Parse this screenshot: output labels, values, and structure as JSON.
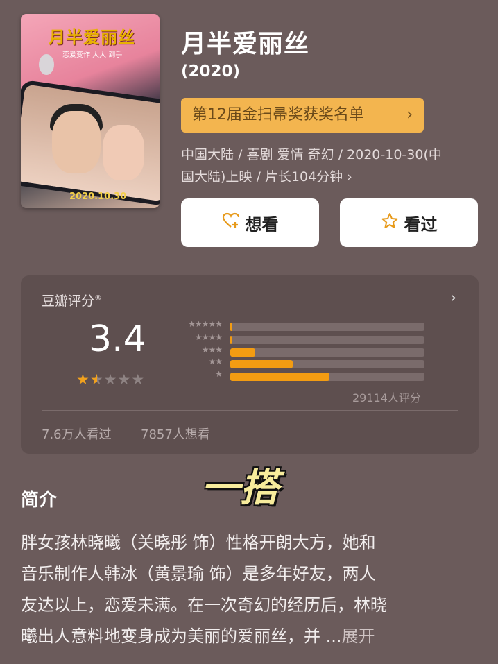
{
  "poster": {
    "title": "月半爱丽丝",
    "subtitle": "恋爱变作 大大 到手",
    "date": "2020.10.30"
  },
  "movie": {
    "title": "月半爱丽丝",
    "year": "(2020)",
    "award": "第12届金扫帚奖获奖名单",
    "meta_line1": "中国大陆 / 喜剧 爱情 奇幻 / 2020-10-30(中",
    "meta_line2": "国大陆)上映 / 片长104分钟 ›"
  },
  "actions": {
    "want_label": "想看",
    "seen_label": "看过"
  },
  "rating": {
    "label": "豆瓣评分",
    "registered": "®",
    "score": "3.4",
    "stars_filled": 1.5,
    "stars_total": 5,
    "distribution": [
      {
        "stars": "★★★★★",
        "fraction": 0.012
      },
      {
        "stars": "★★★★",
        "fraction": 0.008
      },
      {
        "stars": "★★★",
        "fraction": 0.13
      },
      {
        "stars": "★★",
        "fraction": 0.32
      },
      {
        "stars": "★",
        "fraction": 0.51
      }
    ],
    "count": "29114人评分",
    "watched": "7.6万人看过",
    "wish": "7857人想看"
  },
  "overlay_text": "一搭",
  "intro": {
    "heading": "简介",
    "lines": [
      "胖女孩林晓曦（关晓彤 饰）性格开朗大方，她和",
      "音乐制作人韩冰（黄景瑜 饰）是多年好友，两人",
      "友达以上，恋爱未满。在一次奇幻的经历后，林晓",
      "曦出人意料地变身成为美丽的爱丽丝，并 ..."
    ],
    "more": "展开"
  },
  "colors": {
    "background": "#6b5b5b",
    "accent": "#f39c12",
    "award_bg": "#f3b54f"
  }
}
